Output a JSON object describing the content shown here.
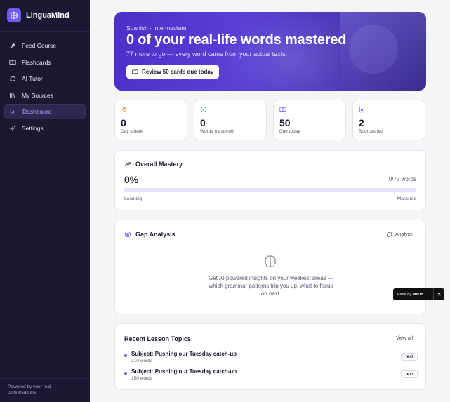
{
  "app": {
    "name": "LinguaMind",
    "footer": "Powered by your real conversations"
  },
  "nav": [
    {
      "label": "Feed Course",
      "icon": "rocket-icon"
    },
    {
      "label": "Flashcards",
      "icon": "book-open-icon"
    },
    {
      "label": "AI Tutor",
      "icon": "chat-bubble-icon"
    },
    {
      "label": "My Sources",
      "icon": "library-icon"
    },
    {
      "label": "Dashboard",
      "icon": "bar-chart-icon",
      "active": true
    },
    {
      "label": "Settings",
      "icon": "gear-icon"
    }
  ],
  "hero": {
    "subtitle": "Spanish · Intermediate",
    "title": "0 of your real-life words mastered",
    "description": "77 more to go — every word came from your actual texts.",
    "button_label": "Review 50 cards due today"
  },
  "stats": [
    {
      "value": "0",
      "label": "Day streak",
      "icon": "flame-icon",
      "color": "#e8833a"
    },
    {
      "value": "0",
      "label": "Words mastered",
      "icon": "check-circle-icon",
      "color": "#2e9e5b"
    },
    {
      "value": "50",
      "label": "Due today",
      "icon": "book-open-icon",
      "color": "#6f5cf0"
    },
    {
      "value": "2",
      "label": "Sources fed",
      "icon": "bar-chart-icon",
      "color": "#6f5cf0"
    }
  ],
  "mastery": {
    "title": "Overall Mastery",
    "percent_label": "0%",
    "count_label": "0/77 words",
    "progress": 0,
    "low_label": "Learning",
    "high_label": "Mastered"
  },
  "gap": {
    "title": "Gap Analysis",
    "action_label": "Analyze",
    "empty_text": "Get AI-powered insights on your weakest areas — which grammar patterns trip you up, what to focus on next."
  },
  "recent": {
    "title": "Recent Lesson Topics",
    "action_label": "View all",
    "items": [
      {
        "title": "Subject: Pushing our Tuesday catch-up",
        "words": "310 words",
        "tag": "text"
      },
      {
        "title": "Subject: Pushing our Tuesday catch-up",
        "words": "150 words",
        "tag": "text"
      }
    ]
  },
  "badge": {
    "prefix": "Made by",
    "brand": "MeDo",
    "close": "✕"
  },
  "colors": {
    "accent": "#6f5cf0",
    "sidebar": "#1b1833",
    "progress_track": "#e6e0fa"
  }
}
